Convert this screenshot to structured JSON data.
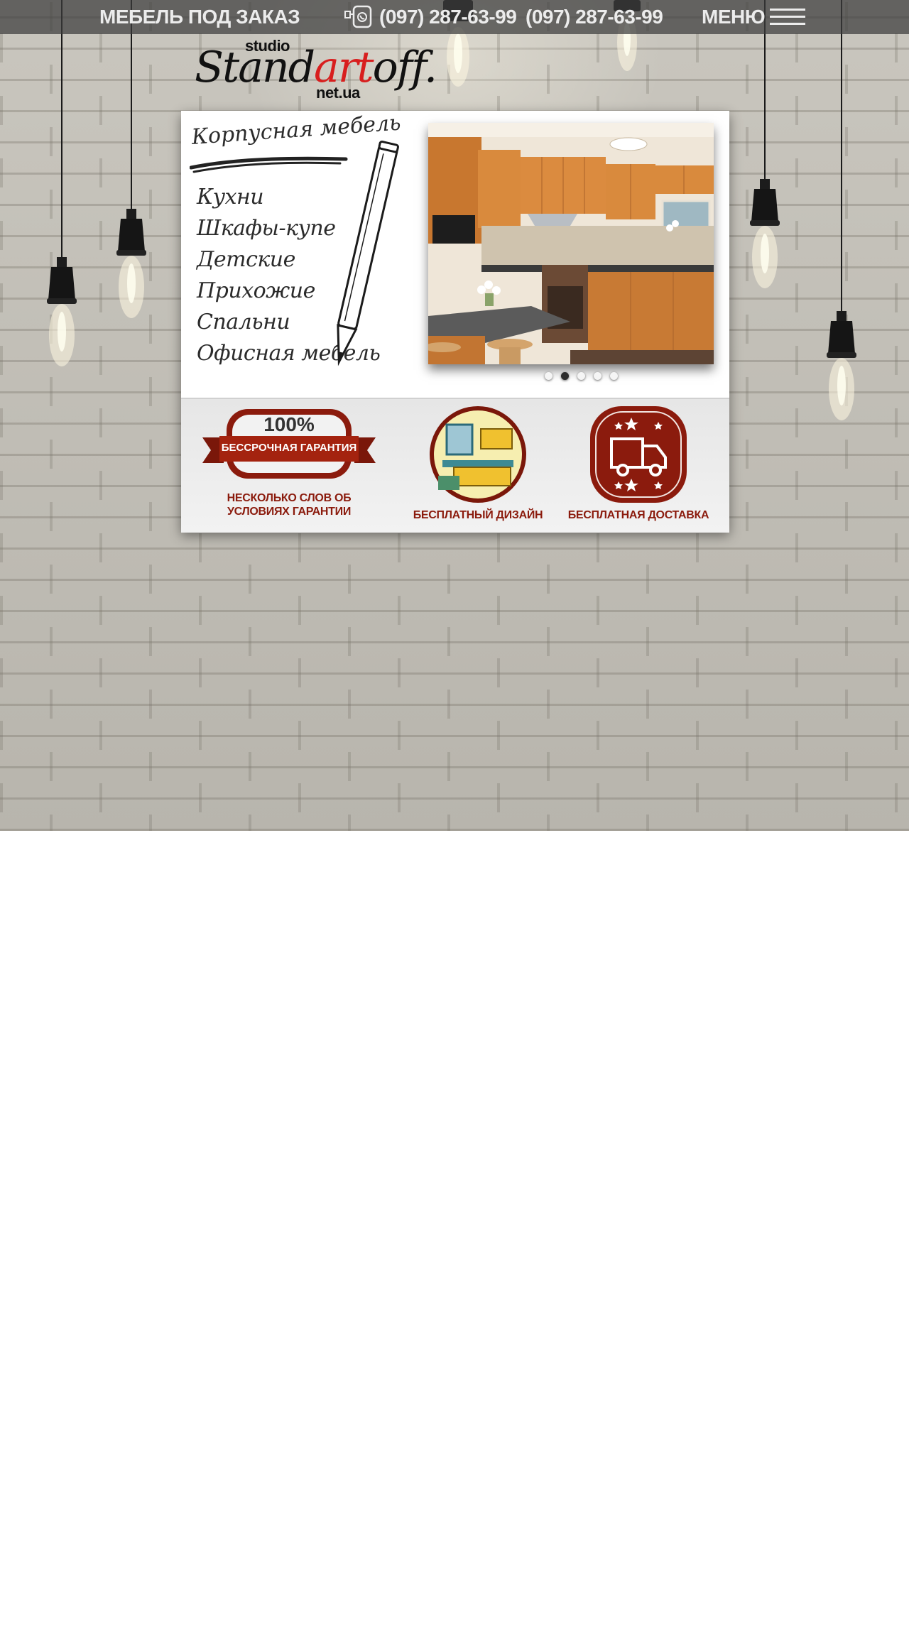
{
  "topbar": {
    "tagline": "МЕБЕЛЬ ПОД ЗАКАЗ",
    "phone_1": "(097) 287-63-99",
    "phone_2": "(097) 287-63-99",
    "menu_label": "МЕНЮ",
    "phone_icon": "phone-viber-icon",
    "menu_icon": "hamburger-icon"
  },
  "logo": {
    "top": "studio",
    "part_a": "Stand",
    "part_b": "art",
    "part_c": "off.",
    "bottom": "net.ua"
  },
  "catalog": {
    "title": "Корпусная мебель",
    "items": [
      "Кухни",
      "Шкафы-купе",
      "Детские",
      "Прихожие",
      "Спальни",
      "Офисная мебель"
    ]
  },
  "slider": {
    "total_slides": 5,
    "active_slide": 2
  },
  "features": {
    "guarantee": {
      "percent": "100%",
      "ribbon": "БЕССРОЧНАЯ ГАРАНТИЯ",
      "link": "НЕСКОЛЬКО СЛОВ ОБ УСЛОВИЯХ ГАРАНТИИ"
    },
    "design": {
      "label": "БЕСПЛАТНЫЙ ДИЗАЙН"
    },
    "delivery": {
      "label": "БЕСПЛАТНАЯ ДОСТАВКА"
    }
  },
  "colors": {
    "accent_red": "#8b1b0d",
    "logo_red": "#d81e1e",
    "topbar_bg": "#3c3c3c"
  }
}
